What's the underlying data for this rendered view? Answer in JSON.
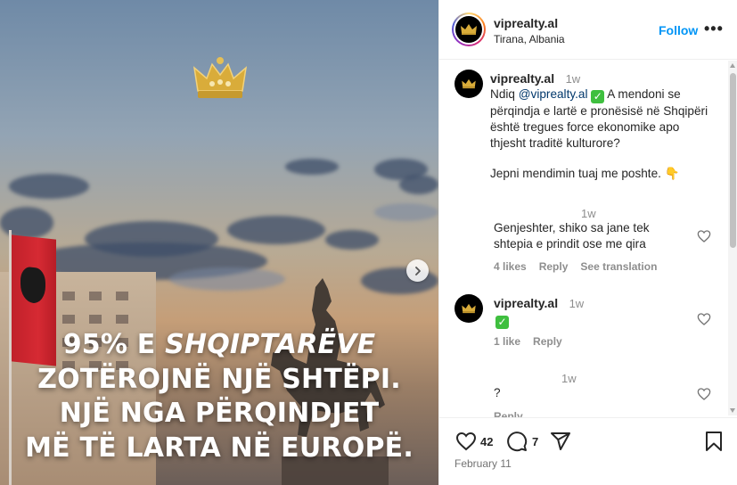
{
  "post": {
    "headline": {
      "line1_prefix": "95% E ",
      "line1_italic": "SHQIPTARËVE",
      "line2": "ZOTËROJNË NJË SHTËPI.",
      "line3": "NJË NGA PËRQINDJET",
      "line4": "MË TË LARTA NË EUROPË."
    },
    "next_icon": "chevron-right-icon"
  },
  "header": {
    "username": "viprealty.al",
    "location": "Tirana, Albania",
    "follow_label": "Follow",
    "more_label": "•••"
  },
  "caption": {
    "username": "viprealty.al",
    "time": "1w",
    "text_prefix": "Ndiq ",
    "mention": "@viprealty.al",
    "text_body": " A mendoni se përqindja e lartë e pronësisë në Shqipëri është tregues force ekonomike apo thjesht traditë kulturore?",
    "text_cta": "Jepni mendimin tuaj me poshte. 👇"
  },
  "comments": [
    {
      "username": "",
      "time": "1w",
      "text": "Genjeshter, shiko sa jane tek shtepia e prindit ose me qira",
      "likes": "4 likes",
      "reply_label": "Reply",
      "translate_label": "See translation"
    },
    {
      "username": "viprealty.al",
      "time": "1w",
      "text": "✓",
      "likes": "1 like",
      "reply_label": "Reply"
    },
    {
      "username": "",
      "time": "1w",
      "text": "?",
      "reply_label": "Reply"
    }
  ],
  "actions": {
    "likes_count": "42",
    "comments_count": "7",
    "date": "February 11"
  },
  "colors": {
    "follow": "#0095f6",
    "mention": "#00376b",
    "muted": "#8e8e8e",
    "check": "#3fbf3f"
  }
}
